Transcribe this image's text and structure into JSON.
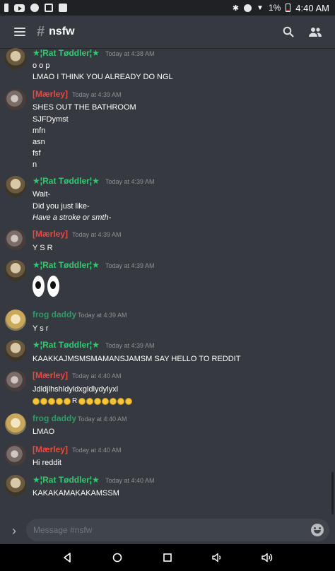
{
  "status_bar": {
    "battery": "1%",
    "time": "4:40 AM"
  },
  "header": {
    "hash": "#",
    "channel_name": "nsfw"
  },
  "messages": [
    {
      "author": "★¦Rat Tøddler¦★",
      "timestamp": "Today at 4:38 AM",
      "lines": [
        "o o p",
        "LMAO I THINK YOU ALREADY DO NGL"
      ]
    },
    {
      "author": "[Mærley]",
      "timestamp": "Today at 4:39 AM",
      "lines": [
        "SHES OUT THE BATHROOM",
        "SJFDymst",
        "mfn",
        "asn",
        "fsf",
        "n"
      ]
    },
    {
      "author": "★¦Rat Tøddler¦★",
      "timestamp": "Today at 4:39 AM",
      "lines": [
        "Wait-",
        "Did you just like-",
        "Have a stroke or smth-"
      ]
    },
    {
      "author": "[Mærley]",
      "timestamp": "Today at 4:39 AM",
      "lines": [
        "Y S R"
      ]
    },
    {
      "author": "★¦Rat Tøddler¦★",
      "timestamp": "Today at 4:39 AM",
      "content_icon": "eyes-emoji"
    },
    {
      "author": "frog daddy",
      "timestamp": "Today at 4:39 AM",
      "lines": [
        "Y s r"
      ]
    },
    {
      "author": "★¦Rat Tøddler¦★",
      "timestamp": "Today at 4:39 AM",
      "lines": [
        "KAAKKAJMSMSMAMANSJAMSM SAY HELLO TO REDDIT"
      ]
    },
    {
      "author": "[Mærley]",
      "timestamp": "Today at 4:40 AM",
      "lines": [
        "Jdldjlhshldyldxgldlydylyxl"
      ],
      "emoji_letter": "R",
      "emoji_icon": "tired-face-emoji"
    },
    {
      "author": "frog daddy",
      "timestamp": "Today at 4:40 AM",
      "lines": [
        "LMAO"
      ]
    },
    {
      "author": "[Mærley]",
      "timestamp": "Today at 4:40 AM",
      "lines": [
        "Hi reddit"
      ]
    },
    {
      "author": "★¦Rat Tøddler¦★",
      "timestamp": "Today at 4:40 AM",
      "lines": [
        "KAKAKAMAKAKAMSSM"
      ]
    }
  ],
  "input": {
    "placeholder": "Message #nsfw"
  },
  "icons": {
    "menu": "hamburger-icon",
    "search": "search-icon",
    "members": "members-icon",
    "expand": "chevron-right-icon",
    "emoji": "emoji-icon",
    "nav": [
      "back-icon",
      "home-icon",
      "recents-icon",
      "volume-down-icon",
      "volume-up-icon"
    ]
  },
  "colors": {
    "background": "#36393f",
    "rat_name": "#2ecc71",
    "marley_name": "#e74c3c",
    "frog_name": "#2e9b6a"
  }
}
